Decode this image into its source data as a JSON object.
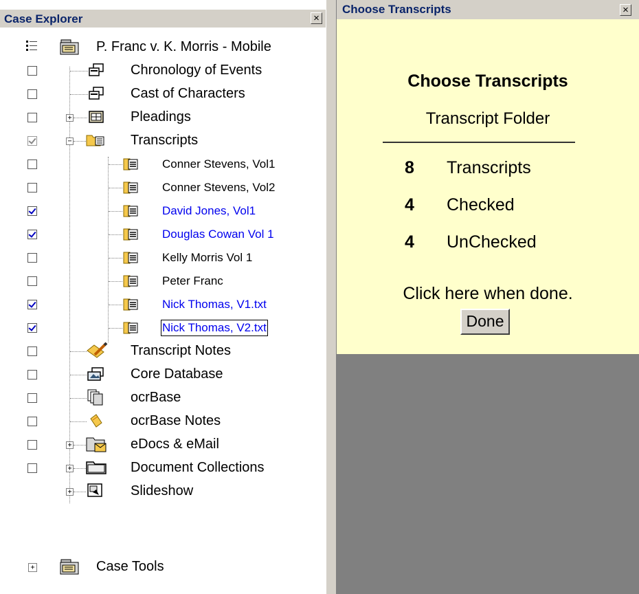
{
  "explorer": {
    "title": "Case Explorer",
    "close_glyph": "×",
    "root": {
      "label": "P. Franc v. K. Morris - Mobile",
      "icon": "case-folder-icon"
    },
    "items": [
      {
        "label": "Chronology of Events",
        "icon": "stack-icon",
        "checked": false
      },
      {
        "label": "Cast of Characters",
        "icon": "stack-icon",
        "checked": false
      },
      {
        "label": "Pleadings",
        "icon": "pleadings-icon",
        "checked": false,
        "expander": "+"
      },
      {
        "label": "Transcripts",
        "icon": "transcript-folder-icon",
        "checked": true,
        "disabled": true,
        "expander": "−"
      },
      {
        "label": "Conner Stevens, Vol1",
        "icon": "transcript-icon",
        "checked": false
      },
      {
        "label": "Conner Stevens, Vol2",
        "icon": "transcript-icon",
        "checked": false
      },
      {
        "label": "David Jones, Vol1",
        "icon": "transcript-icon",
        "checked": true
      },
      {
        "label": "Douglas Cowan Vol 1",
        "icon": "transcript-icon",
        "checked": true
      },
      {
        "label": "Kelly Morris Vol 1",
        "icon": "transcript-icon",
        "checked": false
      },
      {
        "label": "Peter Franc",
        "icon": "transcript-icon",
        "checked": false
      },
      {
        "label": "Nick Thomas, V1.txt",
        "icon": "transcript-icon",
        "checked": true
      },
      {
        "label": "Nick Thomas, V2.txt",
        "icon": "transcript-icon",
        "checked": true
      },
      {
        "label": "Transcript Notes",
        "icon": "pencil-note-icon",
        "checked": false
      },
      {
        "label": "Core Database",
        "icon": "database-icon",
        "checked": false
      },
      {
        "label": "ocrBase",
        "icon": "documents-icon",
        "checked": false
      },
      {
        "label": "ocrBase Notes",
        "icon": "note-icon",
        "checked": false
      },
      {
        "label": "eDocs & eMail",
        "icon": "email-folder-icon",
        "checked": false,
        "expander": "+"
      },
      {
        "label": "Document Collections",
        "icon": "folder-icon",
        "checked": false,
        "expander": "+"
      },
      {
        "label": "Slideshow",
        "icon": "slideshow-icon",
        "expander": "+"
      }
    ],
    "case_tools": {
      "label": "Case Tools",
      "expander": "+",
      "icon": "case-folder-icon"
    }
  },
  "chooser": {
    "title": "Choose Transcripts",
    "close_glyph": "×",
    "heading": "Choose Transcripts",
    "subheading": "Transcript Folder",
    "stats": [
      {
        "num": "8",
        "label": "Transcripts"
      },
      {
        "num": "4",
        "label": "Checked"
      },
      {
        "num": "4",
        "label": "UnChecked"
      }
    ],
    "done_text": "Click here when done.",
    "done_button": "Done"
  },
  "colors": {
    "panel": "#ffffcc",
    "link_blue": "#0000ee",
    "chrome": "#d4d0c8",
    "gray_area": "#808080"
  }
}
